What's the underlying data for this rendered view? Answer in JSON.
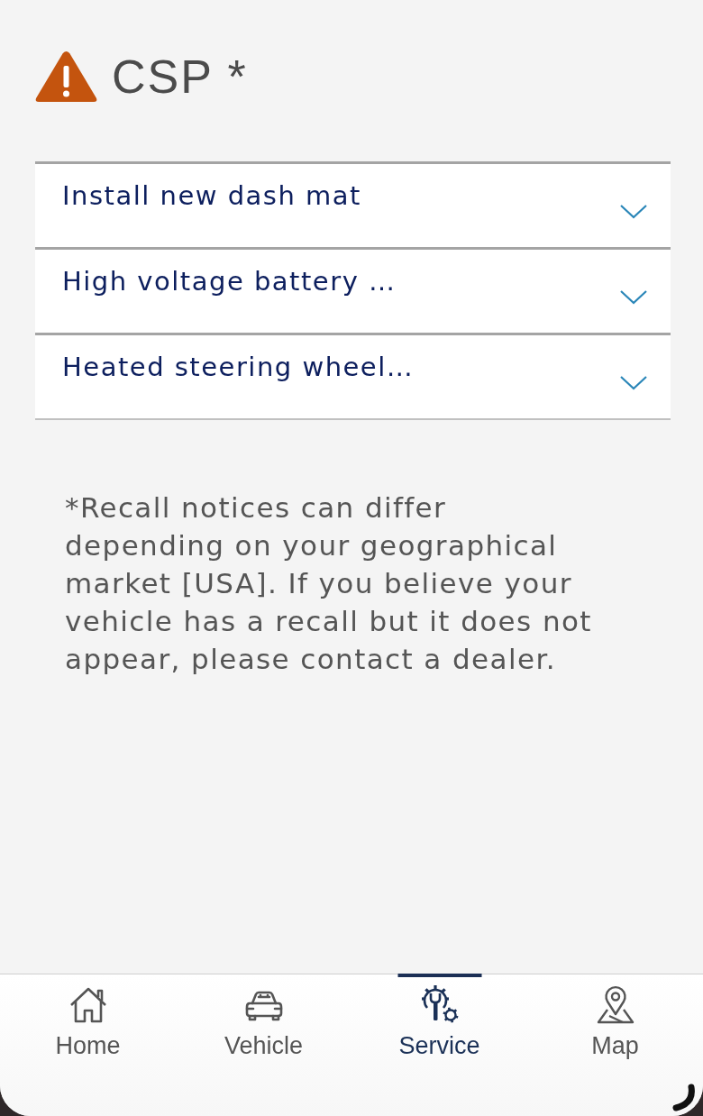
{
  "header": {
    "title": "CSP *"
  },
  "recalls": [
    {
      "title": "Install new dash mat",
      "expanded": false
    },
    {
      "title": "High voltage battery …",
      "expanded": false
    },
    {
      "title": "Heated steering wheel…",
      "expanded": false
    }
  ],
  "footnote": "*Recall notices can differ depending on your geographical market [USA]. If you believe your vehicle has a recall but it does not appear, please contact a dealer.",
  "tab_bar": {
    "tabs": [
      {
        "label": "Home",
        "selected": false
      },
      {
        "label": "Vehicle",
        "selected": false
      },
      {
        "label": "Service",
        "selected": true
      },
      {
        "label": "Map",
        "selected": false
      }
    ]
  }
}
